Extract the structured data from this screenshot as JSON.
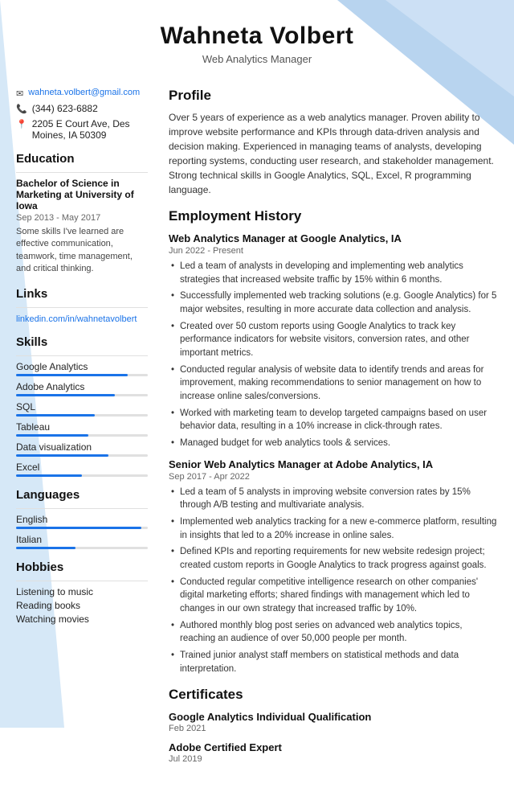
{
  "header": {
    "name": "Wahneta Volbert",
    "title": "Web Analytics Manager"
  },
  "contact": {
    "email": "wahneta.volbert@gmail.com",
    "phone": "(344) 623-6882",
    "address": "2205 E Court Ave, Des Moines, IA 50309"
  },
  "education": {
    "section_title": "Education",
    "degree": "Bachelor of Science in Marketing at University of Iowa",
    "dates": "Sep 2013 - May 2017",
    "description": "Some skills I've learned are effective communication, teamwork, time management, and critical thinking."
  },
  "links": {
    "section_title": "Links",
    "items": [
      {
        "text": "linkedin.com/in/wahnetavolbert",
        "url": "#"
      }
    ]
  },
  "skills": {
    "section_title": "Skills",
    "items": [
      {
        "label": "Google Analytics",
        "level": 85
      },
      {
        "label": "Adobe Analytics",
        "level": 75
      },
      {
        "label": "SQL",
        "level": 60
      },
      {
        "label": "Tableau",
        "level": 55
      },
      {
        "label": "Data visualization",
        "level": 70
      },
      {
        "label": "Excel",
        "level": 50
      }
    ]
  },
  "languages": {
    "section_title": "Languages",
    "items": [
      {
        "label": "English",
        "level": 95
      },
      {
        "label": "Italian",
        "level": 45
      }
    ]
  },
  "hobbies": {
    "section_title": "Hobbies",
    "items": [
      "Listening to music",
      "Reading books",
      "Watching movies"
    ]
  },
  "profile": {
    "section_title": "Profile",
    "text": "Over 5 years of experience as a web analytics manager. Proven ability to improve website performance and KPIs through data-driven analysis and decision making. Experienced in managing teams of analysts, developing reporting systems, conducting user research, and stakeholder management. Strong technical skills in Google Analytics, SQL, Excel, R programming language."
  },
  "employment": {
    "section_title": "Employment History",
    "jobs": [
      {
        "title": "Web Analytics Manager at Google Analytics, IA",
        "dates": "Jun 2022 - Present",
        "bullets": [
          "Led a team of analysts in developing and implementing web analytics strategies that increased website traffic by 15% within 6 months.",
          "Successfully implemented web tracking solutions (e.g. Google Analytics) for 5 major websites, resulting in more accurate data collection and analysis.",
          "Created over 50 custom reports using Google Analytics to track key performance indicators for website visitors, conversion rates, and other important metrics.",
          "Conducted regular analysis of website data to identify trends and areas for improvement, making recommendations to senior management on how to increase online sales/conversions.",
          "Worked with marketing team to develop targeted campaigns based on user behavior data, resulting in a 10% increase in click-through rates.",
          "Managed budget for web analytics tools & services."
        ]
      },
      {
        "title": "Senior Web Analytics Manager at Adobe Analytics, IA",
        "dates": "Sep 2017 - Apr 2022",
        "bullets": [
          "Led a team of 5 analysts in improving website conversion rates by 15% through A/B testing and multivariate analysis.",
          "Implemented web analytics tracking for a new e-commerce platform, resulting in insights that led to a 20% increase in online sales.",
          "Defined KPIs and reporting requirements for new website redesign project; created custom reports in Google Analytics to track progress against goals.",
          "Conducted regular competitive intelligence research on other companies' digital marketing efforts; shared findings with management which led to changes in our own strategy that increased traffic by 10%.",
          "Authored monthly blog post series on advanced web analytics topics, reaching an audience of over 50,000 people per month.",
          "Trained junior analyst staff members on statistical methods and data interpretation."
        ]
      }
    ]
  },
  "certificates": {
    "section_title": "Certificates",
    "items": [
      {
        "name": "Google Analytics Individual Qualification",
        "date": "Feb 2021"
      },
      {
        "name": "Adobe Certified Expert",
        "date": "Jul 2019"
      }
    ]
  }
}
